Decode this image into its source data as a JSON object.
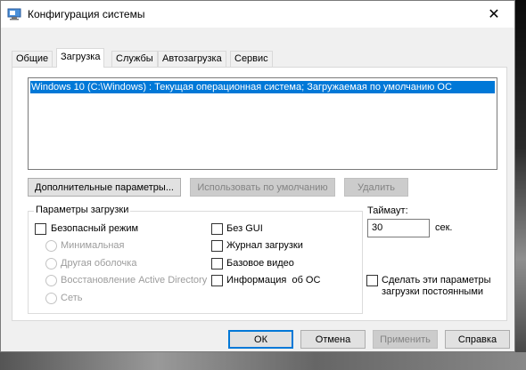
{
  "window": {
    "title": "Конфигурация системы",
    "close_symbol": "✕"
  },
  "tabs": [
    {
      "label": "Общие"
    },
    {
      "label": "Загрузка"
    },
    {
      "label": "Службы"
    },
    {
      "label": "Автозагрузка"
    },
    {
      "label": "Сервис"
    }
  ],
  "active_tab": "Загрузка",
  "boot_list": {
    "items": [
      "Windows 10 (C:\\Windows) : Текущая операционная система; Загружаемая по умолчанию ОС"
    ]
  },
  "boot_buttons": {
    "advanced": "Дополнительные параметры...",
    "set_default": "Использовать по умолчанию",
    "delete": "Удалить"
  },
  "boot_options": {
    "legend": "Параметры загрузки",
    "safe_boot": "Безопасный режим",
    "minimal": "Минимальная",
    "alternate_shell": "Другая оболочка",
    "ad_repair": "Восстановление Active Directory",
    "network": "Сеть",
    "no_gui": "Без GUI",
    "boot_log": "Журнал загрузки",
    "base_video": "Базовое видео",
    "os_boot_info": "Информация  об ОС"
  },
  "timeout": {
    "label": "Таймаут:",
    "value": "30",
    "unit": "сек."
  },
  "make_permanent": {
    "line1": "Сделать эти параметры",
    "line2": "загрузки постоянными"
  },
  "footer_buttons": {
    "ok": "ОК",
    "cancel": "Отмена",
    "apply": "Применить",
    "help": "Справка"
  },
  "colors": {
    "selection": "#0078d7",
    "window_bg": "#f0f0f0"
  }
}
